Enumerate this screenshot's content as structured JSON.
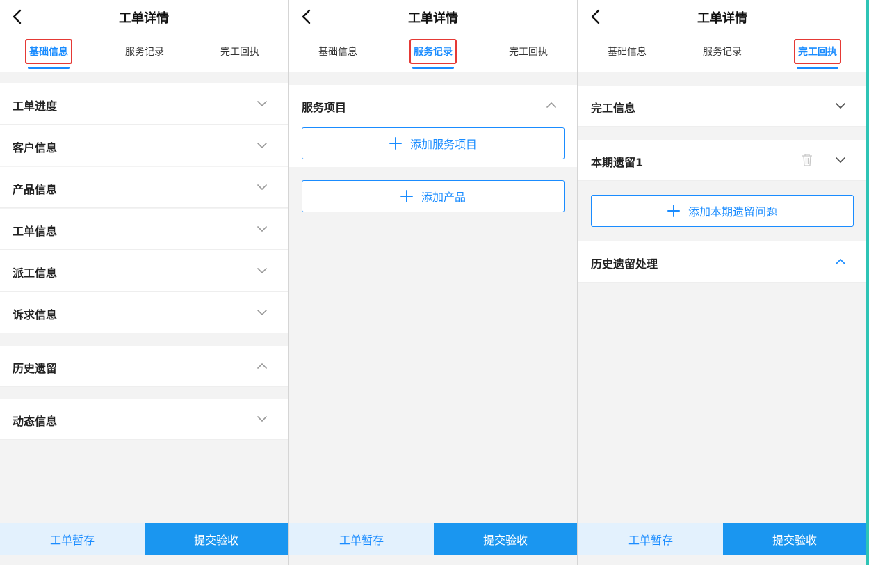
{
  "colors": {
    "accent": "#1a8cff",
    "submit_bg": "#1a96f0",
    "save_bg": "#e3f1fd",
    "highlight": "#e53935"
  },
  "screens": [
    {
      "title": "工单详情",
      "tabs": [
        "基础信息",
        "服务记录",
        "完工回执"
      ],
      "rows": [
        {
          "label": "工单进度",
          "chevron": "chevron-down-icon"
        },
        {
          "label": "客户信息",
          "chevron": "chevron-down-icon"
        },
        {
          "label": "产品信息",
          "chevron": "chevron-down-icon"
        },
        {
          "label": "工单信息",
          "chevron": "chevron-down-icon"
        },
        {
          "label": "派工信息",
          "chevron": "chevron-down-icon"
        },
        {
          "label": "诉求信息",
          "chevron": "chevron-down-icon"
        },
        {
          "label": "历史遗留",
          "chevron": "chevron-up-icon"
        },
        {
          "label": "动态信息",
          "chevron": "chevron-down-icon"
        }
      ],
      "footer": {
        "save_label": "工单暂存",
        "submit_label": "提交验收"
      }
    },
    {
      "title": "工单详情",
      "tabs": [
        "基础信息",
        "服务记录",
        "完工回执"
      ],
      "rows": [
        {
          "label": "服务项目",
          "chevron": "chevron-up-icon"
        }
      ],
      "buttons": [
        "添加服务项目",
        "添加产品"
      ],
      "footer": {
        "save_label": "工单暂存",
        "submit_label": "提交验收"
      }
    },
    {
      "title": "工单详情",
      "tabs": [
        "基础信息",
        "服务记录",
        "完工回执"
      ],
      "rows": [
        {
          "label": "完工信息",
          "chevron": "chevron-down-icon"
        },
        {
          "label": "本期遗留1",
          "chevron": "chevron-down-icon"
        },
        {
          "label": "历史遗留处理",
          "chevron": "chevron-up-icon"
        }
      ],
      "buttons": [
        "添加本期遗留问题"
      ],
      "footer": {
        "save_label": "工单暂存",
        "submit_label": "提交验收"
      }
    }
  ]
}
